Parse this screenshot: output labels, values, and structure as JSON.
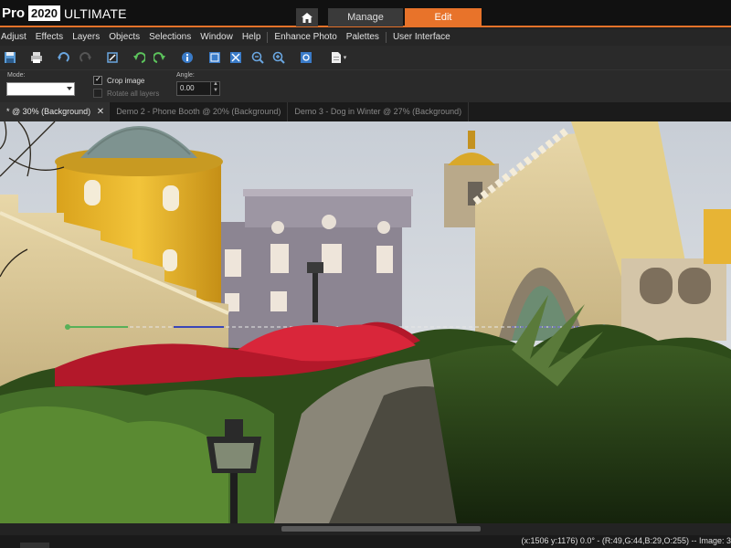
{
  "app": {
    "brand_pro": "Pro",
    "brand_year": "2020",
    "brand_edition": "ULTIMATE",
    "accent": "#e8732a",
    "tabs": [
      {
        "label": "Manage",
        "active": false
      },
      {
        "label": "Edit",
        "active": true
      }
    ]
  },
  "menu": [
    "Adjust",
    "Effects",
    "Layers",
    "Objects",
    "Selections",
    "Window",
    "Help",
    "Enhance Photo",
    "Palettes",
    "User Interface"
  ],
  "toolbar": {
    "icons": [
      "save-icon",
      "print-icon",
      "undo-icon",
      "redo-icon",
      "crop-tool-icon",
      "undo-green-icon",
      "redo-green-icon",
      "info-icon",
      "fit-window-icon",
      "actual-size-icon",
      "zoom-out-icon",
      "zoom-in-icon",
      "fullscreen-icon",
      "new-document-icon"
    ]
  },
  "options": {
    "mode_label": "Mode:",
    "mode_value": "",
    "crop_image_label": "Crop image",
    "crop_image_checked": true,
    "rotate_all_layers_label": "Rotate all layers",
    "rotate_all_layers_enabled": false,
    "angle_label": "Angle:",
    "angle_value": "0.00"
  },
  "documents": [
    {
      "label": "* @  30% (Background)",
      "active": true
    },
    {
      "label": "Demo 2 - Phone Booth @  20% (Background)",
      "active": false
    },
    {
      "label": "Demo 3 - Dog in Winter @  27% (Background)",
      "active": false
    }
  ],
  "status": {
    "text": "(x:1506 y:1176) 0.0° - (R:49,G:44,B:29,O:255) -- Image: 3"
  }
}
